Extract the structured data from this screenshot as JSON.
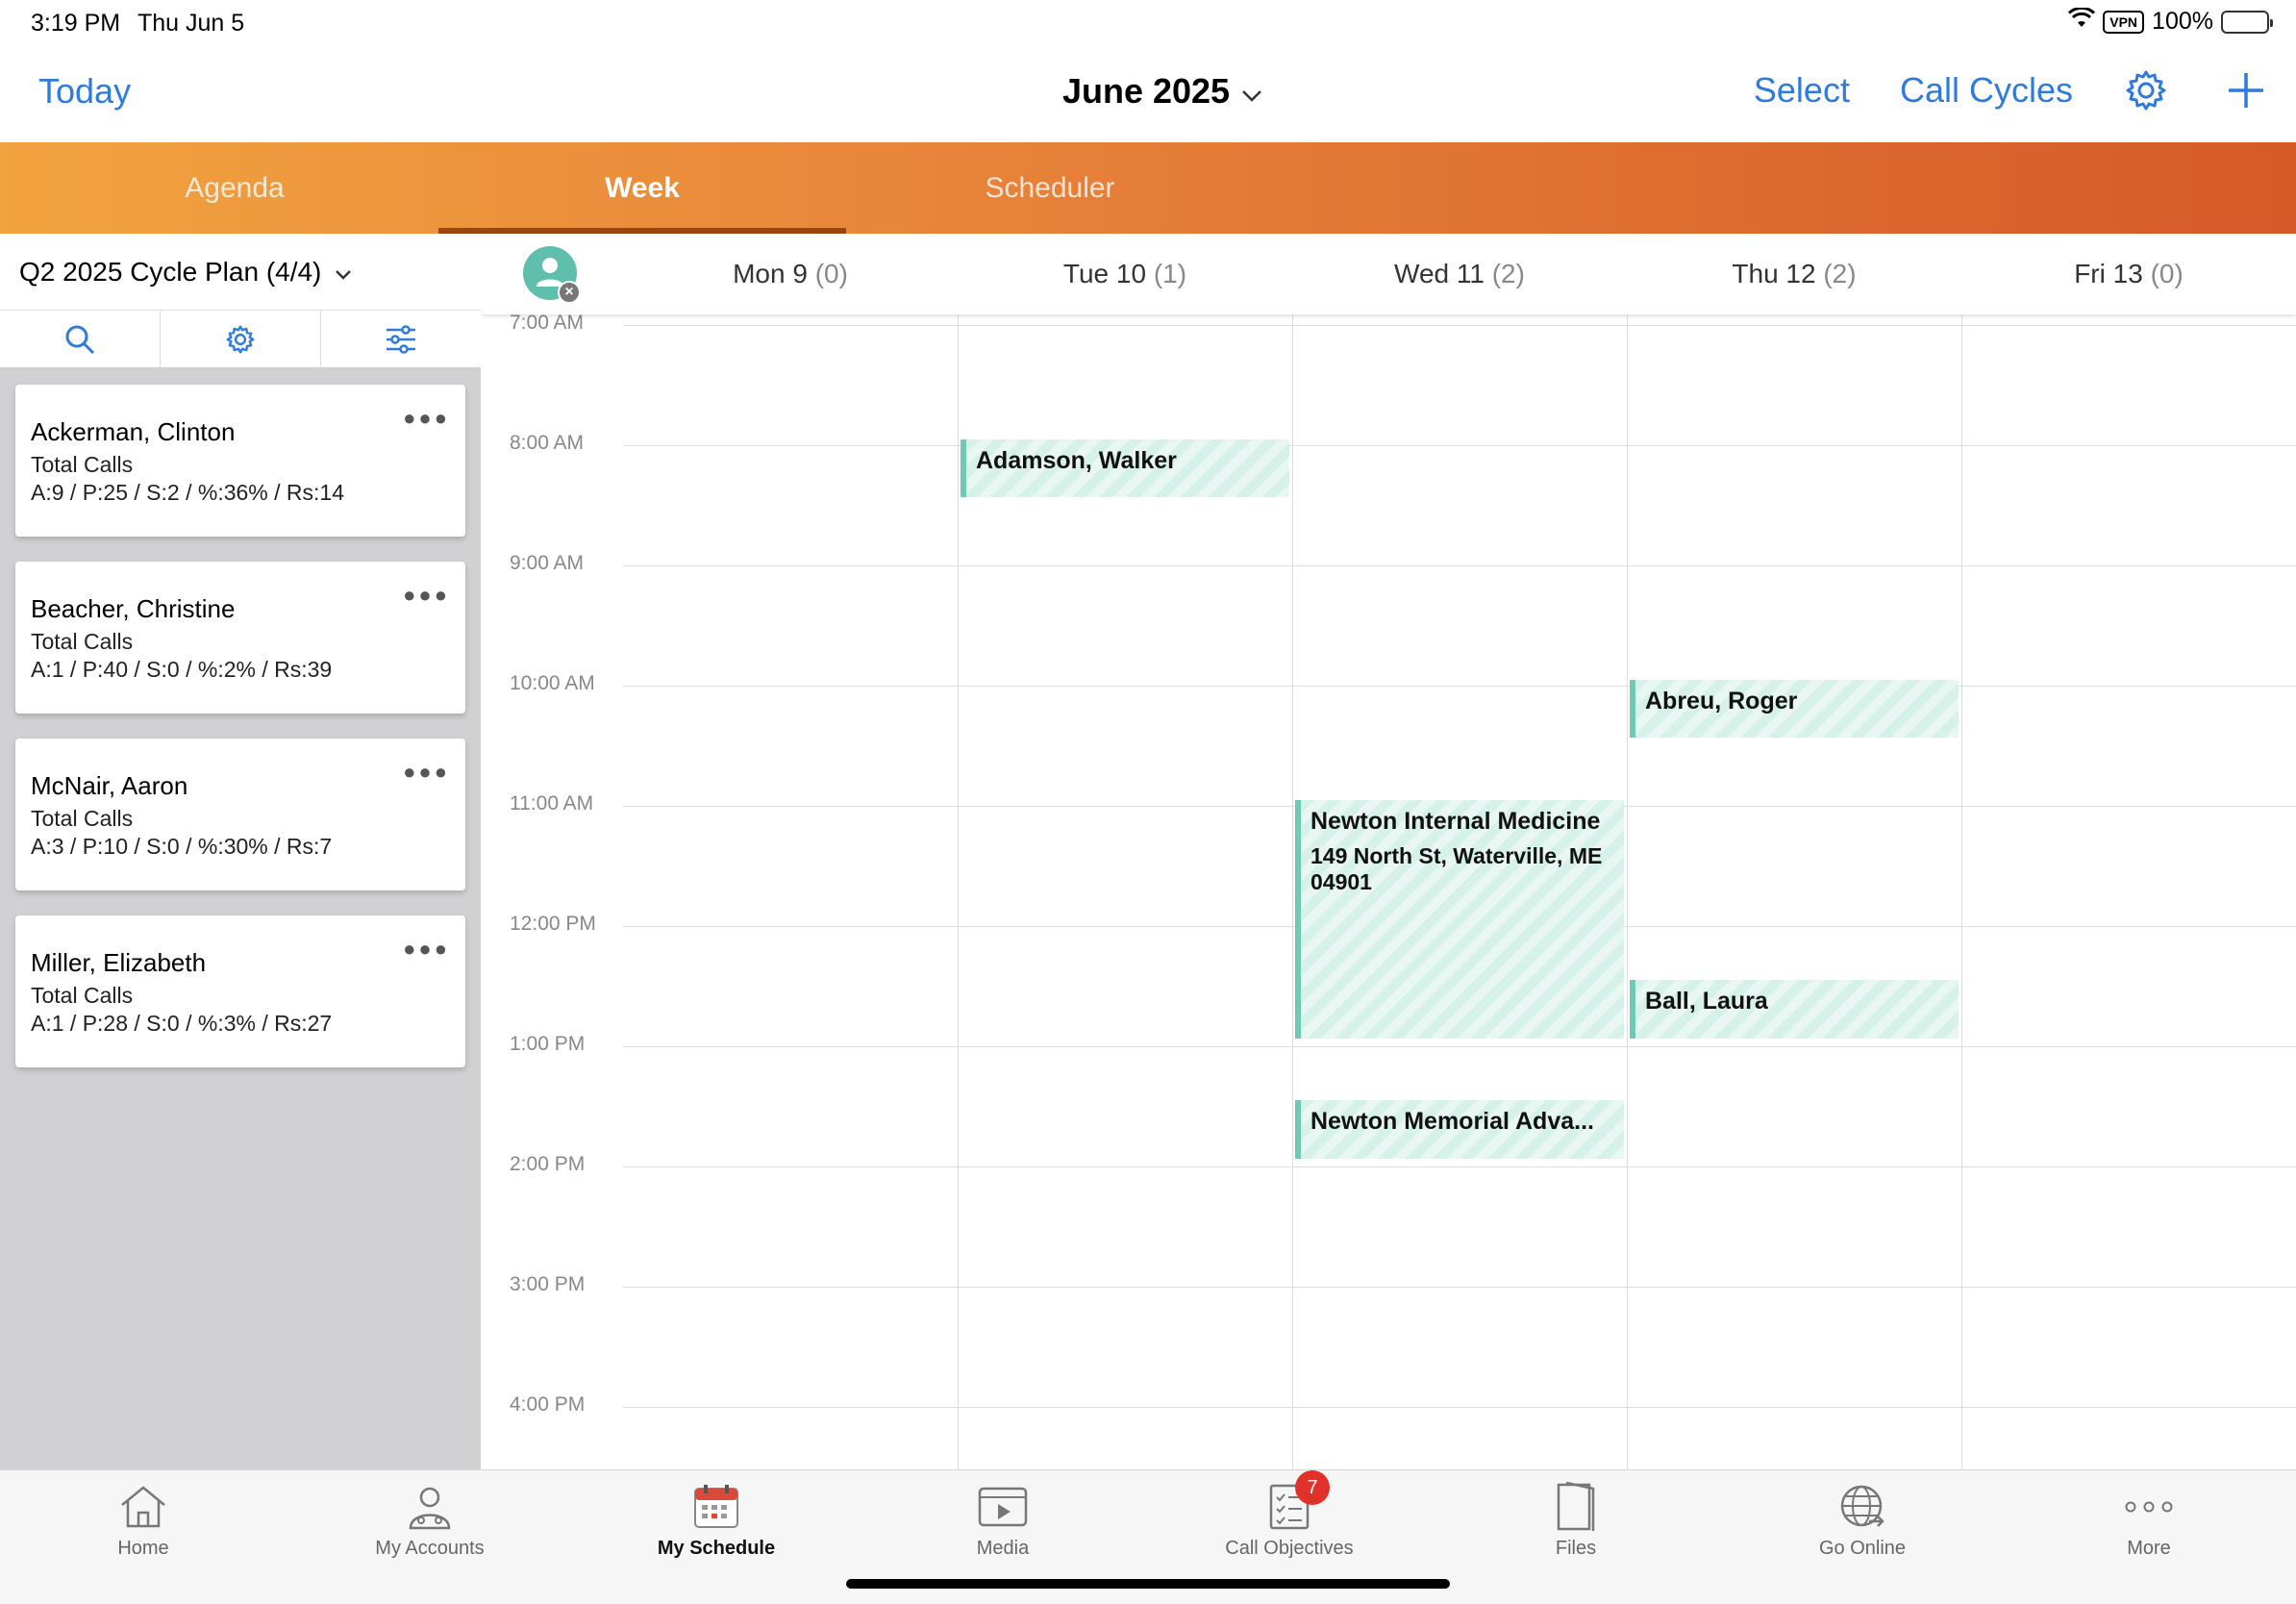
{
  "status": {
    "time": "3:19 PM",
    "date": "Thu Jun 5",
    "vpn": "VPN",
    "battery": "100%"
  },
  "nav": {
    "today": "Today",
    "month": "June 2025",
    "select": "Select",
    "call_cycles": "Call Cycles"
  },
  "view_tabs": [
    {
      "label": "Agenda",
      "active": false
    },
    {
      "label": "Week",
      "active": true
    },
    {
      "label": "Scheduler",
      "active": false
    }
  ],
  "left_panel": {
    "plan_title": "Q2 2025 Cycle Plan (4/4)",
    "cards": [
      {
        "name": "Ackerman, Clinton",
        "label": "Total Calls",
        "stats": "A:9 / P:25 / S:2 / %:36% / Rs:14"
      },
      {
        "name": "Beacher, Christine",
        "label": "Total Calls",
        "stats": "A:1 / P:40 / S:0 / %:2% / Rs:39"
      },
      {
        "name": "McNair, Aaron",
        "label": "Total Calls",
        "stats": "A:3 / P:10 / S:0 / %:30% / Rs:7"
      },
      {
        "name": "Miller, Elizabeth",
        "label": "Total Calls",
        "stats": "A:1 / P:28 / S:0 / %:3% / Rs:27"
      }
    ]
  },
  "calendar": {
    "days": [
      {
        "label": "Mon 9",
        "count": "(0)"
      },
      {
        "label": "Tue 10",
        "count": "(1)"
      },
      {
        "label": "Wed 11",
        "count": "(2)"
      },
      {
        "label": "Thu 12",
        "count": "(2)"
      },
      {
        "label": "Fri 13",
        "count": "(0)"
      }
    ],
    "hours": [
      "7:00 AM",
      "8:00 AM",
      "9:00 AM",
      "10:00 AM",
      "11:00 AM",
      "12:00 PM",
      "1:00 PM",
      "2:00 PM",
      "3:00 PM",
      "4:00 PM"
    ],
    "events": [
      {
        "title": "Adamson, Walker",
        "address": "",
        "day": "Tue 10",
        "start": "8:00 AM",
        "end": "8:30 AM"
      },
      {
        "title": "Abreu, Roger",
        "address": "",
        "day": "Thu 12",
        "start": "10:00 AM",
        "end": "10:30 AM"
      },
      {
        "title": "Newton Internal Medicine",
        "address": "149 North St, Waterville, ME 04901",
        "day": "Wed 11",
        "start": "11:00 AM",
        "end": "1:00 PM"
      },
      {
        "title": "Ball, Laura",
        "address": "",
        "day": "Thu 12",
        "start": "12:30 PM",
        "end": "1:00 PM"
      },
      {
        "title": "Newton Memorial Adva...",
        "address": "",
        "day": "Wed 11",
        "start": "1:30 PM",
        "end": "2:00 PM"
      }
    ],
    "event_color": "#6fc9b4"
  },
  "bottom_tabs": [
    {
      "label": "Home",
      "icon": "home-icon",
      "active": false
    },
    {
      "label": "My Accounts",
      "icon": "accounts-icon",
      "active": false
    },
    {
      "label": "My Schedule",
      "icon": "calendar-icon",
      "active": true
    },
    {
      "label": "Media",
      "icon": "media-icon",
      "active": false
    },
    {
      "label": "Call Objectives",
      "icon": "checklist-icon",
      "active": false,
      "badge": "7"
    },
    {
      "label": "Files",
      "icon": "files-icon",
      "active": false
    },
    {
      "label": "Go Online",
      "icon": "globe-icon",
      "active": false
    },
    {
      "label": "More",
      "icon": "more-icon",
      "active": false
    }
  ],
  "colors": {
    "accent": "#2f7bdc",
    "tab_gradient_start": "#f1a33f",
    "tab_gradient_end": "#d55a28",
    "badge": "#e0322a"
  }
}
